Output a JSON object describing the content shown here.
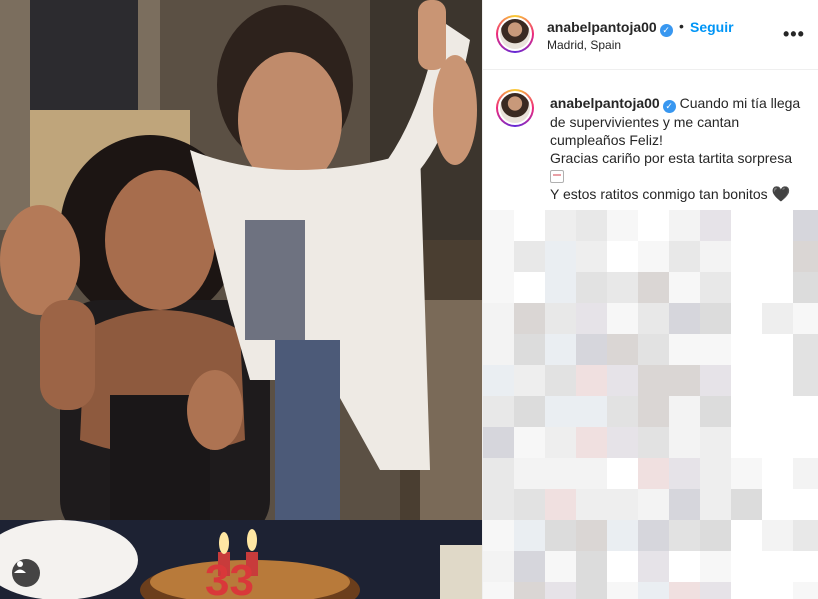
{
  "post": {
    "username": "anabelpantoja00",
    "follow_label": "Seguir",
    "separator": "•",
    "location": "Madrid, Spain",
    "more_label": "•••",
    "verified_mark": "✓"
  },
  "caption": {
    "username": "anabelpantoja00",
    "line1": "Cuando mi tía llega de supervivientes y me cantan cumpleaños Feliz!",
    "line2": "Gracias cariño por esta tartita sorpresa",
    "line3": "Y estos ratitos conmigo tan bonitos",
    "heart_emoji": "🖤",
    "cake_emoji": "cake-emoji"
  },
  "media": {
    "cake_number": "33",
    "user_button_icon": "user-icon"
  },
  "colors": {
    "link_blue": "#0095f6",
    "verified_blue": "#3897f0",
    "text": "#262626"
  }
}
